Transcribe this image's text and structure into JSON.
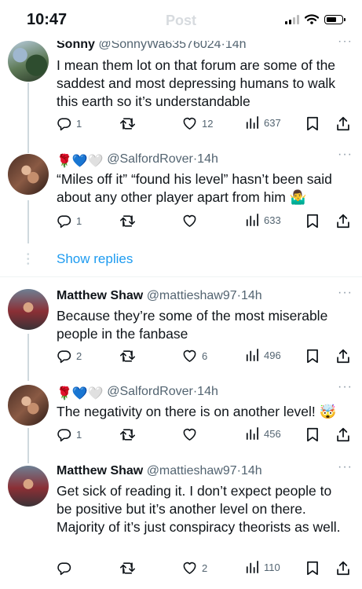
{
  "status_bar": {
    "time": "10:47",
    "screen_title": "Post"
  },
  "tweets": [
    {
      "name": "Sonny",
      "handle": "@SonnyWa63576024",
      "time": "14h",
      "text": "I mean them lot on that forum are some of the saddest and most depressing humans to walk this earth so it’s understandable",
      "replies": "1",
      "retweets": "",
      "likes": "12",
      "views": "637"
    },
    {
      "name_emoji": "🌹💙🤍",
      "handle": "@SalfordRover",
      "time": "14h",
      "text": "“Miles off it” “found his level” hasn’t been said about any other player apart from him 🤷‍♂️",
      "replies": "1",
      "retweets": "",
      "likes": "",
      "views": "633"
    },
    {
      "name": "Matthew Shaw",
      "handle": "@mattieshaw97",
      "time": "14h",
      "text": "Because they’re some of the most miserable people in the fanbase",
      "replies": "2",
      "retweets": "",
      "likes": "6",
      "views": "496"
    },
    {
      "name_emoji": "🌹💙🤍",
      "handle": "@SalfordRover",
      "time": "14h",
      "text": "The negativity on there is on another level! 🤯",
      "replies": "1",
      "retweets": "",
      "likes": "",
      "views": "456"
    },
    {
      "name": "Matthew Shaw",
      "handle": "@mattieshaw97",
      "time": "14h",
      "text": "Get sick of reading it. I don’t expect people to be positive but it’s another level on there. Majority of it’s just conspiracy theorists as well.",
      "replies": "",
      "retweets": "",
      "likes": "2",
      "views": "110"
    }
  ],
  "show_replies": "Show replies",
  "separator": "·",
  "more": "···",
  "colors": {
    "accent": "#1d9bf0",
    "muted": "#536471"
  }
}
